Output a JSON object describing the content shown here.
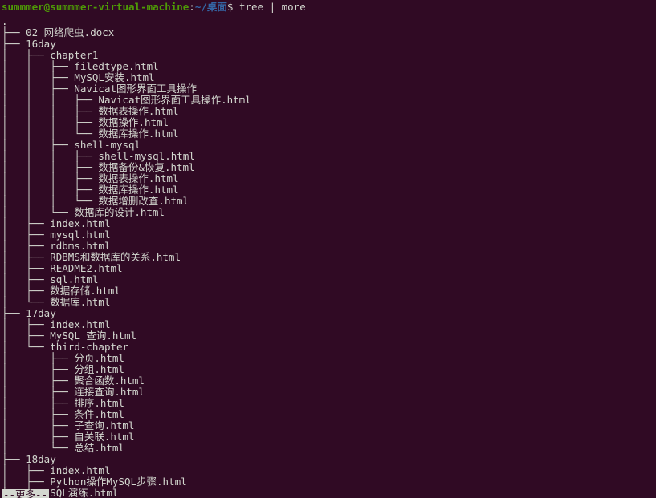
{
  "terminal": {
    "background_color": "#300a24",
    "foreground_color": "#d3d7cf",
    "prompt": {
      "user_host": "summmer@summmer-virtual-machine",
      "user_host_color": "#4e9a06",
      "colon": ":",
      "path": "~/桌面",
      "path_color": "#3465a4",
      "dollar": "$",
      "command": " tree | more"
    },
    "pager": {
      "label": "--更多--"
    }
  },
  "tree": {
    "root": ".",
    "lines": [
      ".",
      "├── 02_网络爬虫.docx",
      "├── 16day",
      "│   ├── chapter1",
      "│   │   ├── filedtype.html",
      "│   │   ├── MySQL安装.html",
      "│   │   ├── Navicat图形界面工具操作",
      "│   │   │   ├── Navicat图形界面工具操作.html",
      "│   │   │   ├── 数据表操作.html",
      "│   │   │   ├── 数据操作.html",
      "│   │   │   └── 数据库操作.html",
      "│   │   ├── shell-mysql",
      "│   │   │   ├── shell-mysql.html",
      "│   │   │   ├── 数据备份&恢复.html",
      "│   │   │   ├── 数据表操作.html",
      "│   │   │   ├── 数据库操作.html",
      "│   │   │   └── 数据增删改查.html",
      "│   │   └── 数据库的设计.html",
      "│   ├── index.html",
      "│   ├── mysql.html",
      "│   ├── rdbms.html",
      "│   ├── RDBMS和数据库的关系.html",
      "│   ├── README2.html",
      "│   ├── sql.html",
      "│   ├── 数据存储.html",
      "│   └── 数据库.html",
      "├── 17day",
      "│   ├── index.html",
      "│   ├── MySQL 查询.html",
      "│   └── third-chapter",
      "│       ├── 分页.html",
      "│       ├── 分组.html",
      "│       ├── 聚合函数.html",
      "│       ├── 连接查询.html",
      "│       ├── 排序.html",
      "│       ├── 条件.html",
      "│       ├── 子查询.html",
      "│       ├── 自关联.html",
      "│       └── 总结.html",
      "├── 18day",
      "│   ├── index.html",
      "│   ├── Python操作MySQL步骤.html",
      "│   ├── SQL演练.html"
    ]
  }
}
